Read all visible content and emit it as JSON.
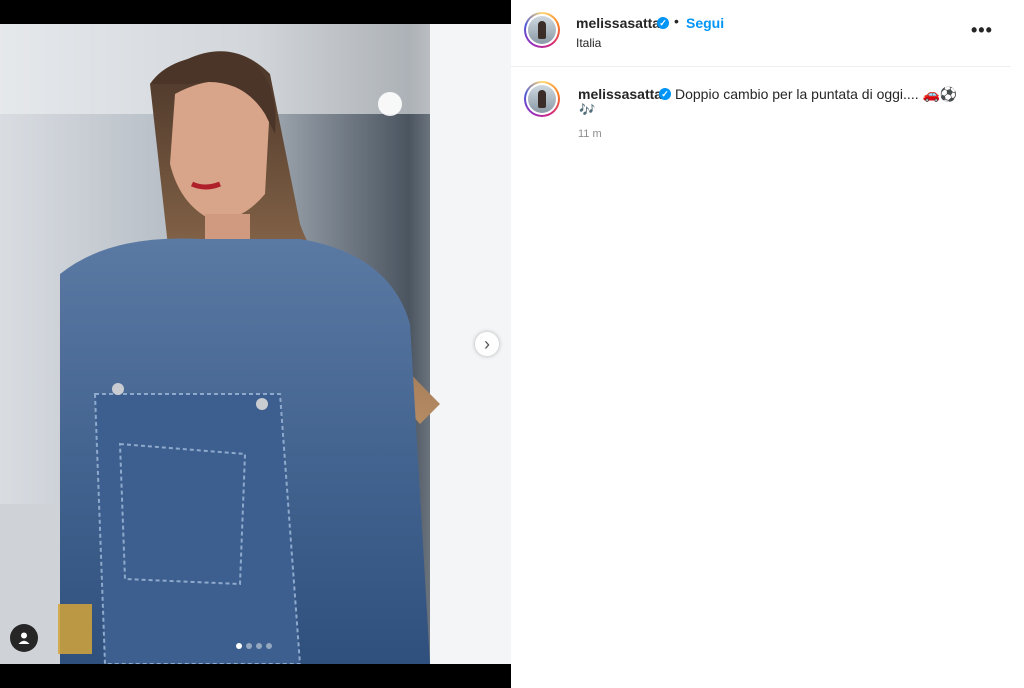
{
  "post": {
    "author": "melissasatta",
    "follow_label": "Segui",
    "separator": "•",
    "location": "Italia",
    "more_label": "•••",
    "caption": "Doppio cambio per la puntata di oggi.... 🚗⚽",
    "caption_extra": "🎶",
    "timestamp": "11 m",
    "carousel": {
      "total": 4,
      "current": 1
    },
    "next_label": "›"
  },
  "colors": {
    "link": "#0095f6",
    "text": "#262626",
    "muted": "#8e8e8e"
  },
  "icons": [
    "verified-badge-icon",
    "chevron-right-icon",
    "user-tag-icon",
    "more-options-icon"
  ]
}
